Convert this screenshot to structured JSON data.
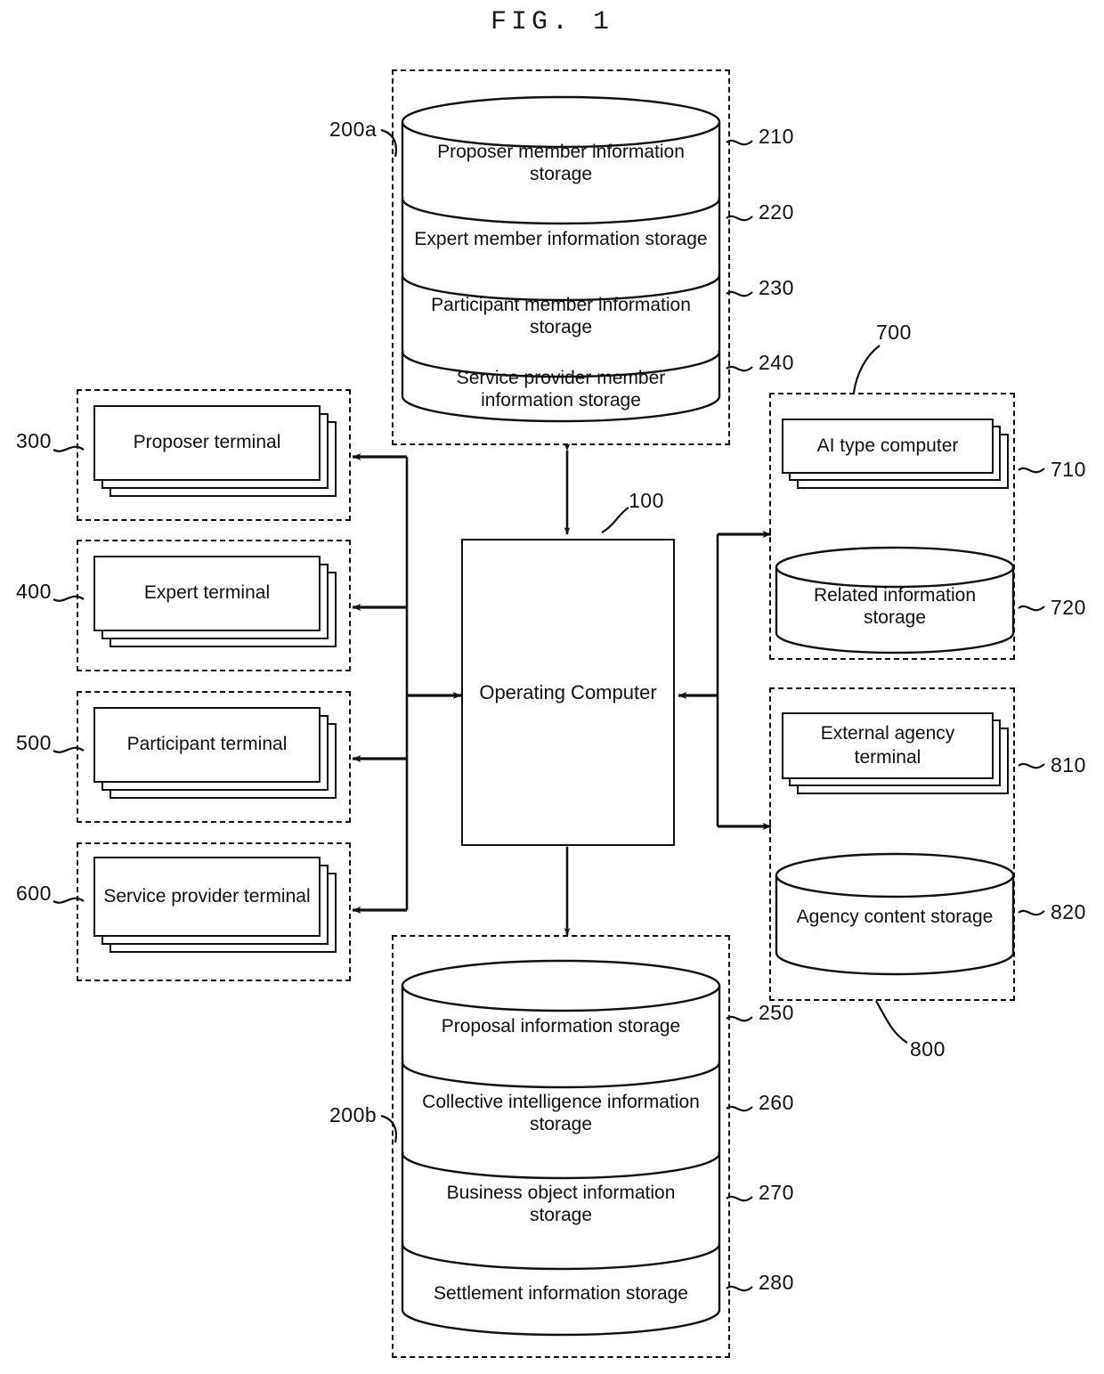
{
  "figure": {
    "title": "FIG. 1"
  },
  "member_db": {
    "ref": "200a",
    "sections": [
      {
        "label": "Proposer member information storage",
        "ref": "210"
      },
      {
        "label": "Expert member information storage",
        "ref": "220"
      },
      {
        "label": "Participant member information storage",
        "ref": "230"
      },
      {
        "label": "Service provider member information storage",
        "ref": "240"
      }
    ]
  },
  "business_db": {
    "ref": "200b",
    "sections": [
      {
        "label": "Proposal information storage",
        "ref": "250"
      },
      {
        "label": "Collective intelligence information storage",
        "ref": "260"
      },
      {
        "label": "Business object information storage",
        "ref": "270"
      },
      {
        "label": "Settlement information storage",
        "ref": "280"
      }
    ]
  },
  "operating_computer": {
    "label": "Operating Computer",
    "ref": "100"
  },
  "terminals": [
    {
      "label": "Proposer terminal",
      "ref": "300"
    },
    {
      "label": "Expert terminal",
      "ref": "400"
    },
    {
      "label": "Participant terminal",
      "ref": "500"
    },
    {
      "label": "Service provider terminal",
      "ref": "600"
    }
  ],
  "ai_group": {
    "ref": "700",
    "computer": {
      "label": "AI type computer",
      "ref": "710"
    },
    "storage": {
      "label": "Related information storage",
      "ref": "720"
    }
  },
  "agency_group": {
    "ref": "800",
    "terminal": {
      "label": "External agency terminal",
      "ref": "810"
    },
    "storage": {
      "label": "Agency content storage",
      "ref": "820"
    }
  }
}
